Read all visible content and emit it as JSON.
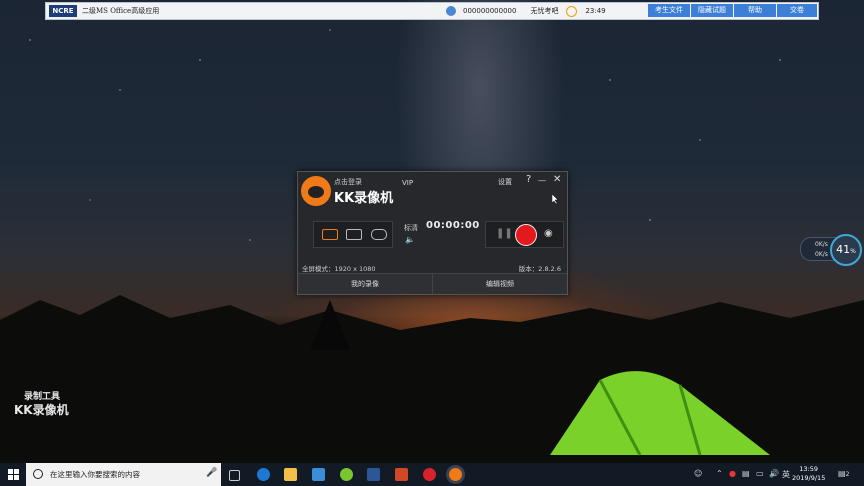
{
  "exam_bar": {
    "title": "二级MS Office高级应用",
    "logo_text": "NCRE",
    "candidate_id": "000000000000",
    "candidate_name": "无忧考吧",
    "time": "23:49",
    "buttons": [
      "考生文件",
      "隐藏试题",
      "帮助",
      "交卷"
    ]
  },
  "kk_window": {
    "login_text": "点击登录",
    "app_name": "KK录像机",
    "vip_label": "VIP",
    "settings_label": "设置",
    "help_glyph": "?",
    "minimize_glyph": "—",
    "close_glyph": "✕",
    "quality_label": "标清",
    "timer": "00:00:00",
    "resolution_text": "全屏模式：1920 x 1080",
    "version_text": "版本：2.8.2.6",
    "my_recordings_label": "我的录像",
    "edit_video_label": "编辑视频"
  },
  "speed_widget": {
    "percent": "41",
    "percent_unit": "%",
    "upload": "0K/s",
    "download": "0K/s"
  },
  "watermark": {
    "line1": "录制工具",
    "line2": "KK录像机"
  },
  "taskbar": {
    "search_placeholder": "在这里输入你要搜索的内容",
    "ime_label": "英",
    "time": "13:59",
    "date": "2019/9/15",
    "notification_count": "2"
  },
  "colors": {
    "accent_blue": "#3d7fd6",
    "record_red": "#e3191b",
    "kk_orange": "#f07a18"
  }
}
